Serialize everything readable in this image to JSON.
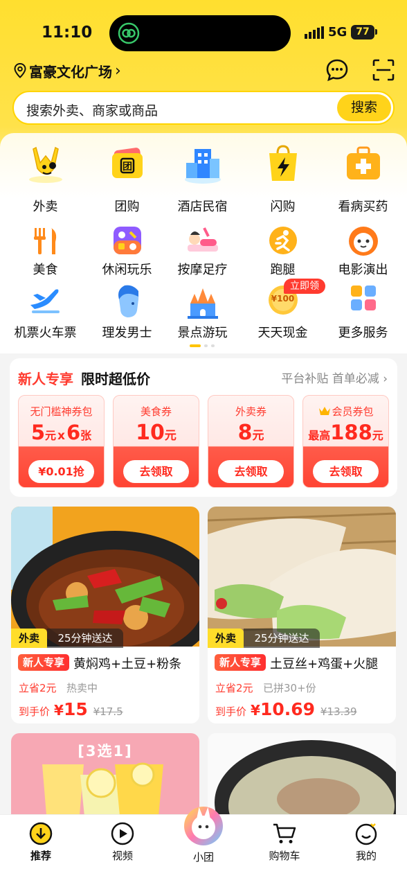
{
  "status_bar": {
    "time": "11:10",
    "network": "5G",
    "battery": "77"
  },
  "header": {
    "location": "富豪文化广场",
    "message_icon": "message-icon",
    "scan_icon": "scan-icon"
  },
  "search": {
    "placeholder": "搜索外卖、商家或商品",
    "button": "搜索"
  },
  "categories": [
    {
      "label": "外卖",
      "icon": "takeout-mascot-icon"
    },
    {
      "label": "团购",
      "icon": "group-buy-icon"
    },
    {
      "label": "酒店民宿",
      "icon": "hotel-icon"
    },
    {
      "label": "闪购",
      "icon": "flash-buy-icon"
    },
    {
      "label": "看病买药",
      "icon": "medicine-icon"
    },
    {
      "label": "美食",
      "icon": "food-icon"
    },
    {
      "label": "休闲玩乐",
      "icon": "leisure-icon"
    },
    {
      "label": "按摩足疗",
      "icon": "massage-icon"
    },
    {
      "label": "跑腿",
      "icon": "errand-icon"
    },
    {
      "label": "电影演出",
      "icon": "movie-icon"
    },
    {
      "label": "机票火车票",
      "icon": "flight-icon"
    },
    {
      "label": "理发男士",
      "icon": "haircut-icon"
    },
    {
      "label": "景点游玩",
      "icon": "attraction-icon"
    },
    {
      "label": "天天现金",
      "icon": "cash-icon",
      "coin_text": "¥100"
    },
    {
      "label": "更多服务",
      "icon": "more-services-icon"
    }
  ],
  "cash_badge": "立即领",
  "promo": {
    "title_red": "新人专享",
    "title_black": "限时超低价",
    "right_text": "平台补贴 首单必减",
    "coupons": [
      {
        "title": "无门槛神券包",
        "value_a": "5",
        "unit_a": "元",
        "times": "x",
        "value_b": "6",
        "unit_b": "张",
        "button": "¥0.01抢"
      },
      {
        "title": "美食券",
        "value": "10",
        "unit": "元",
        "button": "去领取"
      },
      {
        "title": "外卖券",
        "value": "8",
        "unit": "元",
        "button": "去领取"
      },
      {
        "title": "会员券包",
        "prefix": "最高",
        "value": "188",
        "unit": "元",
        "button": "去领取"
      }
    ]
  },
  "feed": [
    {
      "type": "外卖",
      "delivery": "25分钟送达",
      "badge": "新人专享",
      "title": "黄焖鸡+土豆+粉条",
      "save": "立省2元",
      "meta": "热卖中",
      "price_label": "到手价",
      "currency": "¥",
      "price": "15",
      "old_price": "¥17.5"
    },
    {
      "type": "外卖",
      "delivery": "25分钟送达",
      "badge": "新人专享",
      "title": "土豆丝+鸡蛋+火腿",
      "save": "立省2元",
      "meta": "已拼30+份",
      "price_label": "到手价",
      "currency": "¥",
      "price": "10.69",
      "old_price": "¥13.39"
    },
    {
      "overlay": "[3选1]"
    },
    {}
  ],
  "tabbar": [
    {
      "label": "推荐",
      "icon": "recommend-icon",
      "active": true
    },
    {
      "label": "视频",
      "icon": "video-icon"
    },
    {
      "label": "小团",
      "icon": "xiaotuan-mascot-icon"
    },
    {
      "label": "购物车",
      "icon": "cart-icon"
    },
    {
      "label": "我的",
      "icon": "profile-icon"
    }
  ],
  "colors": {
    "brand_yellow": "#ffd31a",
    "accent_red": "#ff2a1f"
  }
}
